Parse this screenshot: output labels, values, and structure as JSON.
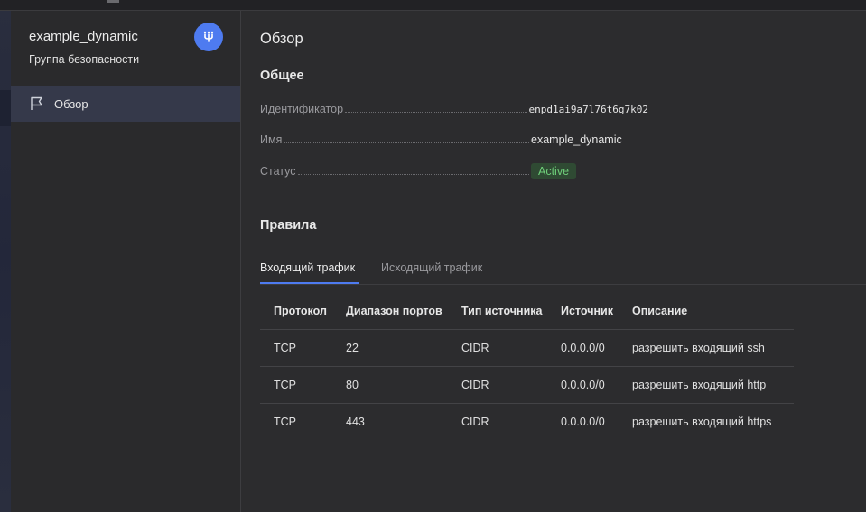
{
  "sidebar": {
    "title": "example_dynamic",
    "subtitle": "Группа безопасности",
    "badge_icon": "network-icon",
    "nav": [
      {
        "label": "Обзор",
        "icon": "flag-icon",
        "active": true
      }
    ]
  },
  "main": {
    "page_title": "Обзор",
    "general": {
      "title": "Общее",
      "fields": [
        {
          "label": "Идентификатор",
          "value": "enpd1ai9a7l76t6g7k02"
        },
        {
          "label": "Имя",
          "value": "example_dynamic"
        },
        {
          "label": "Статус",
          "value": "Active"
        }
      ]
    },
    "rules": {
      "title": "Правила",
      "tabs": [
        {
          "label": "Входящий трафик",
          "active": true
        },
        {
          "label": "Исходящий трафик",
          "active": false
        }
      ],
      "columns": [
        "Протокол",
        "Диапазон портов",
        "Тип источника",
        "Источник",
        "Описание"
      ],
      "rows": [
        [
          "TCP",
          "22",
          "CIDR",
          "0.0.0.0/0",
          "разрешить входящий ssh"
        ],
        [
          "TCP",
          "80",
          "CIDR",
          "0.0.0.0/0",
          "разрешить входящий http"
        ],
        [
          "TCP",
          "443",
          "CIDR",
          "0.0.0.0/0",
          "разрешить входящий https"
        ]
      ]
    }
  },
  "colors": {
    "accent": "#4e7bf0",
    "status_active_bg": "#2f4a33",
    "status_active_fg": "#6fcf7a",
    "sidebar_active_bg": "#35394a"
  }
}
